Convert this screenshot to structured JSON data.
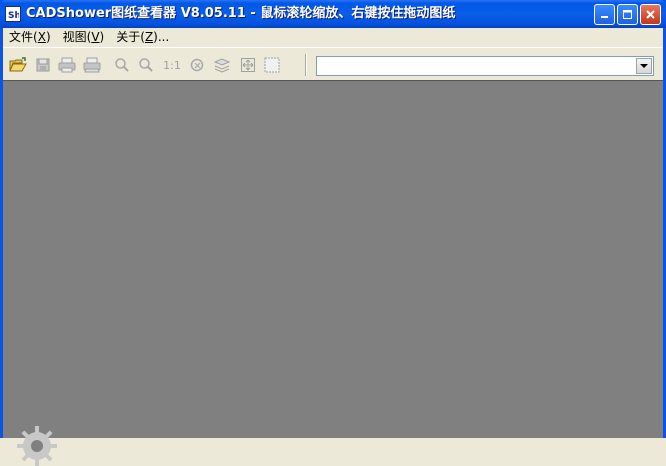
{
  "window": {
    "title": "CADShower图纸查看器 V8.05.11 - 鼠标滚轮缩放、右键按住拖动图纸"
  },
  "menubar": {
    "items": [
      {
        "label": "文件",
        "hotkey": "X"
      },
      {
        "label": "视图",
        "hotkey": "V"
      },
      {
        "label": "关于",
        "hotkey": "Z",
        "suffix": "..."
      }
    ]
  },
  "toolbar": {
    "actual_size_label": "1:1",
    "file_combo": {
      "value": ""
    }
  },
  "colors": {
    "titlebar": "#0a5ee8",
    "canvas": "#808080",
    "chrome": "#ece9d8"
  }
}
